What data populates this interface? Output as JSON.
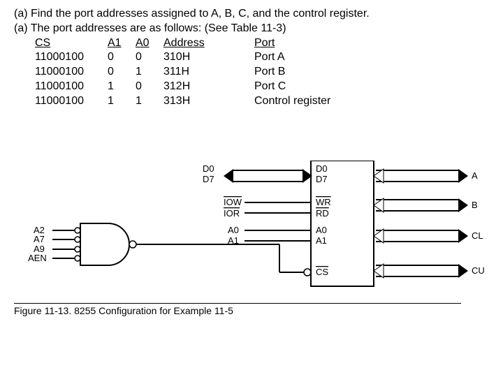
{
  "question": "(a) Find the port addresses assigned to A, B, C, and the control register.",
  "answer_intro": "(a) The port addresses are as follows: (See Table 11-3)",
  "headers": {
    "cs": "CS",
    "a1": "A1",
    "a0": "A0",
    "addr": "Address",
    "port": "Port"
  },
  "rows": [
    {
      "cs": "11000100",
      "a1": "0",
      "a0": "0",
      "addr": "310H",
      "port": "Port A"
    },
    {
      "cs": "11000100",
      "a1": "0",
      "a0": "1",
      "addr": "311H",
      "port": "Port B"
    },
    {
      "cs": "11000100",
      "a1": "1",
      "a0": "0",
      "addr": "312H",
      "port": "Port C"
    },
    {
      "cs": "11000100",
      "a1": "1",
      "a0": "1",
      "addr": "313H",
      "port": "Control register"
    }
  ],
  "diagram": {
    "left_inputs": [
      "A2",
      "A7",
      "A9",
      "AEN"
    ],
    "bus_top": "D0",
    "bus_bottom": "D7",
    "mid_signals": {
      "iow": "IOW",
      "ior": "IOR",
      "a0": "A0",
      "a1": "A1"
    },
    "chip_pins": {
      "d0": "D0",
      "d7": "D7",
      "wr": "WR",
      "rd": "RD",
      "a0": "A0",
      "a1": "A1",
      "cs": "CS"
    },
    "outputs": {
      "a": "A",
      "b": "B",
      "cl": "CL",
      "cu": "CU"
    }
  },
  "caption_prefix": "Figure 11-13.",
  "caption_rest": " 8255 Configuration for Example 11-5"
}
